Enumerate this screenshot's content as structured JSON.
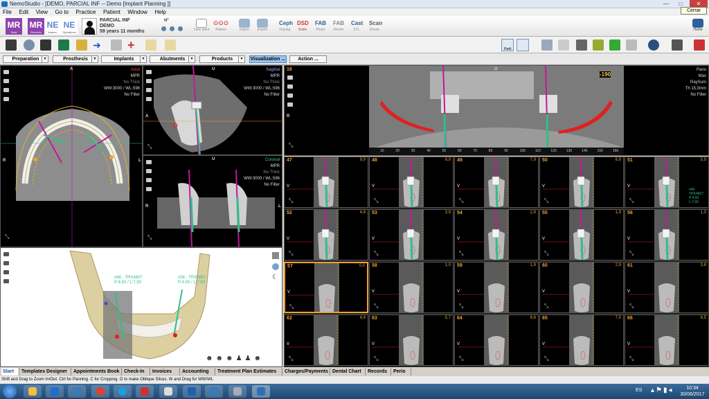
{
  "window": {
    "title": "NemoStudio - [DEMO, PARCIAL INF -- Demo [Implant Planning ]]",
    "close_tooltip": "Cerrar"
  },
  "menu": [
    "File",
    "Edit",
    "View",
    "Go to",
    "Practice",
    "Patient",
    "Window",
    "Help"
  ],
  "ribbon": {
    "tiles": [
      {
        "letters": "MR",
        "sub": "Start",
        "color": "#8e44ad"
      },
      {
        "letters": "MR",
        "sub": "Records",
        "color": "#8e44ad"
      },
      {
        "letters": "NE",
        "sub": "Anamn.",
        "color": "#5b8bd0"
      },
      {
        "letters": "NE",
        "sub": "Operations",
        "color": "#5b8bd0"
      }
    ],
    "patient": {
      "name": "PARCIAL INF",
      "surname": "DEMO",
      "age": "59 years 11 months",
      "num_label": "Nº"
    },
    "view_buttons": [
      "View point",
      "Planes"
    ],
    "io_buttons": [
      "Import",
      "Export"
    ],
    "modules": [
      {
        "label": "Ceph",
        "sub": "Tracing",
        "color": "#2b5d8f"
      },
      {
        "label": "DSD",
        "sub": "Smile",
        "color": "#d03030"
      },
      {
        "label": "FAB",
        "sub": "Photo",
        "color": "#2b5d8f"
      },
      {
        "label": "FAB",
        "sub": "Dicom",
        "color": "#888888"
      },
      {
        "label": "Cast",
        "sub": "STL",
        "color": "#2b5d8f"
      },
      {
        "label": "Scan",
        "sub": "Dicom",
        "color": "#555555"
      }
    ],
    "home_label": "Home",
    "radiology_label": "Radi."
  },
  "workflow": [
    {
      "label": "Preparation",
      "active": false
    },
    {
      "label": "Prosthesis",
      "active": false
    },
    {
      "label": "Implants",
      "active": false
    },
    {
      "label": "Abutments",
      "active": false
    },
    {
      "label": "Products",
      "active": false
    },
    {
      "label": "Visualization ...",
      "active": true
    },
    {
      "label": "Action ...",
      "active": false
    }
  ],
  "views": {
    "axial": {
      "title": "Axial",
      "lines": [
        "MPR",
        "No Thick",
        "WW:3000 / WL:596",
        "No Filter"
      ],
      "top": "A",
      "left": "R",
      "right": "L"
    },
    "sagittal": {
      "title": "Sagittal",
      "lines": [
        "MPR",
        "No Thick",
        "WW:3000 / WL:596",
        "No Filter"
      ],
      "top": "U",
      "left": "A"
    },
    "coronal": {
      "title": "Coronal",
      "lines": [
        "MPR",
        "No Thick",
        "WW:3000 / WL:596",
        "No Filter"
      ],
      "top": "U",
      "left": "R",
      "right": "L"
    },
    "pano": {
      "number": "16",
      "hu": "-190",
      "title": "Pano",
      "lines": [
        "Max",
        "RaySum",
        "Th 15,0mm",
        "No Filter"
      ],
      "top": "U",
      "left": "R",
      "scale": [
        "10",
        "20",
        "30",
        "40",
        "50",
        "60",
        "70",
        "80",
        "90",
        "100",
        "110",
        "120",
        "130",
        "140",
        "150",
        "160"
      ]
    },
    "model3d": {
      "implant_left": "#46 - TRX4607\nP:4,50 / L:7,50",
      "implant_right": "#36 - TRX4607\nP:4,50 / L:7,50"
    }
  },
  "cross_sections": [
    {
      "n": "47",
      "d": "9,9"
    },
    {
      "n": "48",
      "d": "8,9"
    },
    {
      "n": "49",
      "d": "7,9"
    },
    {
      "n": "50",
      "d": "6,9"
    },
    {
      "n": "51",
      "d": "5,9"
    },
    {
      "n": "52",
      "d": "4,9"
    },
    {
      "n": "53",
      "d": "3,9"
    },
    {
      "n": "54",
      "d": "2,9"
    },
    {
      "n": "55",
      "d": "1,9"
    },
    {
      "n": "56",
      "d": "1,0"
    },
    {
      "n": "57",
      "d": "0,0"
    },
    {
      "n": "58",
      "d": "1,0"
    },
    {
      "n": "59",
      "d": "1,9"
    },
    {
      "n": "60",
      "d": "2,9"
    },
    {
      "n": "61",
      "d": "3,8"
    },
    {
      "n": "62",
      "d": "4,8"
    },
    {
      "n": "63",
      "d": "5,7"
    },
    {
      "n": "64",
      "d": "6,6"
    },
    {
      "n": "65",
      "d": "7,5"
    },
    {
      "n": "66",
      "d": "8,5"
    }
  ],
  "cross_selected": "57",
  "cross_implant_label": "#46\nTRX4607\nP:4,50\nL:7,50",
  "cross_v": "V",
  "tabs": [
    "Start",
    "Templates Designer",
    "Appointments Book",
    "Check-In",
    "Invoices",
    "Accounting",
    "Treatment Plan Estimates",
    "Charges/Payments",
    "Dental Chart",
    "Records",
    "Perio"
  ],
  "status": "Shift and Drag to Zoom In/Out. Ctrl for Panning. C for Cropping. O to make Oblique Slices. W and Drag for WW/WL",
  "clock": {
    "time": "10:34",
    "date": "30/06/2017",
    "lang": "ES"
  },
  "colors": {
    "accent": "#9ec4ec",
    "implant": "#2fbf8a",
    "axis": "#c2189a",
    "nerve": "#e02020"
  }
}
